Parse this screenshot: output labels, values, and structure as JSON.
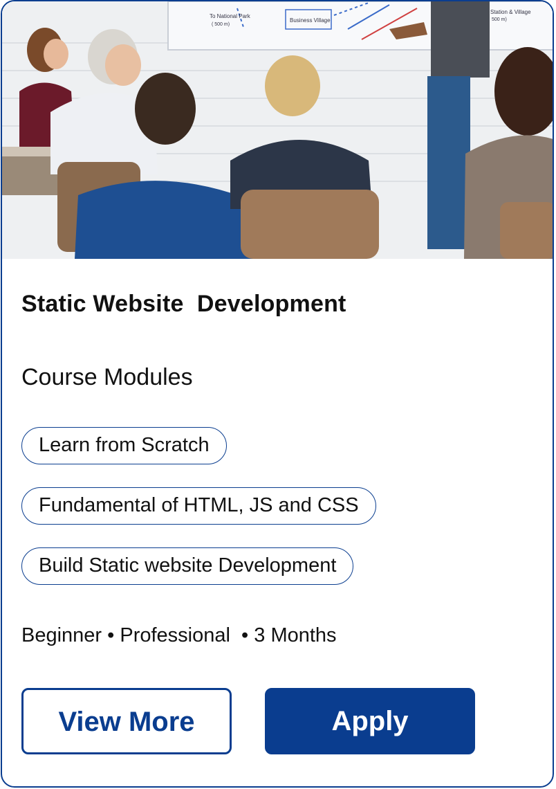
{
  "card": {
    "image": {
      "alt_icon": "classroom-presentation-photo",
      "whiteboard_labels": [
        "To National Park",
        "( 500 m)",
        "Business Village",
        "Station & Village",
        "500 m)"
      ]
    },
    "title": "Static Website  Development",
    "modules_heading": "Course Modules",
    "modules": [
      "Learn from Scratch",
      "Fundamental of HTML, JS and CSS",
      "Build Static website Development"
    ],
    "meta": "Beginner • Professional  • 3 Months",
    "buttons": {
      "view_more": "View More",
      "apply": "Apply"
    }
  },
  "colors": {
    "brand": "#0a3d8f",
    "text": "#111111",
    "background": "#ffffff"
  }
}
